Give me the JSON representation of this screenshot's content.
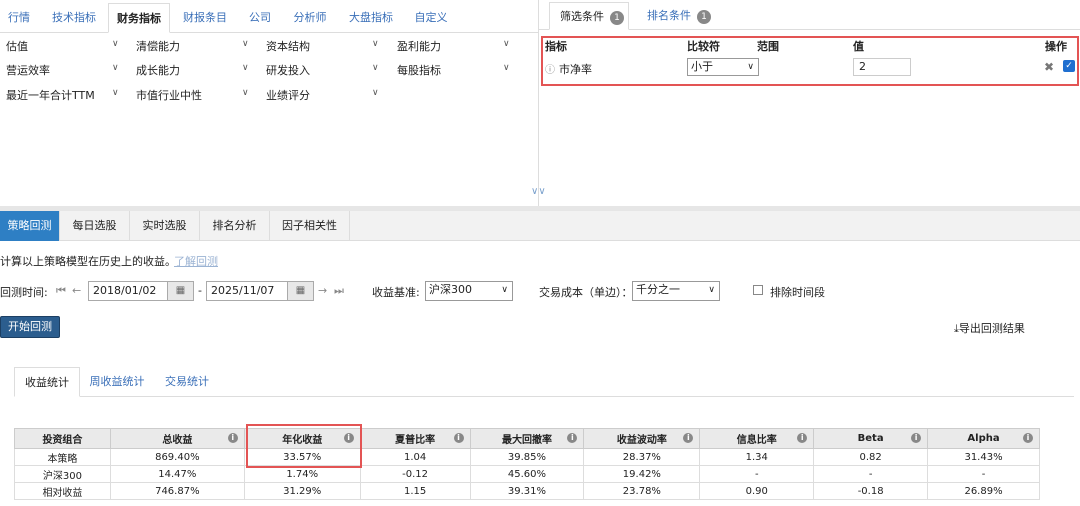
{
  "top_tabs": [
    "行情",
    "技术指标",
    "财务指标",
    "财报条目",
    "公司",
    "分析师",
    "大盘指标",
    "自定义"
  ],
  "filters": [
    [
      "估值",
      "清偿能力",
      "资本结构",
      "盈利能力"
    ],
    [
      "营运效率",
      "成长能力",
      "研发投入",
      "每股指标"
    ],
    [
      "最近一年合计TTM",
      "市值行业中性",
      "业绩评分"
    ]
  ],
  "right_tabs": [
    {
      "label": "筛选条件",
      "count": "1"
    },
    {
      "label": "排名条件",
      "count": "1"
    }
  ],
  "cond_headers": {
    "indicator": "指标",
    "compare": "比较符",
    "range": "范围",
    "value": "值",
    "ops": "操作"
  },
  "condition": {
    "indicator": "市净率",
    "compare": "小于",
    "value": "2"
  },
  "bottom_tabs": [
    "策略回测",
    "每日选股",
    "实时选股",
    "排名分析",
    "因子相关性"
  ],
  "desc": "计算以上策略模型在历史上的收益。",
  "learn_link": "了解回测",
  "backtest_time_label": "回测时间:",
  "start_date": "2018/01/02",
  "end_date": "2025/11/07",
  "dash": "-",
  "benchmark_label": "收益基准:",
  "benchmark": "沪深300",
  "cost_label": "交易成本（单边）：",
  "cost": "千分之一",
  "exclude_label": "排除时间段",
  "run_button": "开始回测",
  "export_button": "导出回测结果",
  "stat_tabs": [
    "收益统计",
    "周收益统计",
    "交易统计"
  ],
  "table": {
    "headers": [
      "投资组合",
      "总收益",
      "年化收益",
      "夏普比率",
      "最大回撤率",
      "收益波动率",
      "信息比率",
      "Beta",
      "Alpha"
    ],
    "rows": [
      [
        "本策略",
        "869.40%",
        "33.57%",
        "1.04",
        "39.85%",
        "28.37%",
        "1.34",
        "0.82",
        "31.43%"
      ],
      [
        "沪深300",
        "14.47%",
        "1.74%",
        "-0.12",
        "45.60%",
        "19.42%",
        "-",
        "-",
        "-"
      ],
      [
        "相对收益",
        "746.87%",
        "31.29%",
        "1.15",
        "39.31%",
        "23.78%",
        "0.90",
        "-0.18",
        "26.89%"
      ]
    ]
  }
}
